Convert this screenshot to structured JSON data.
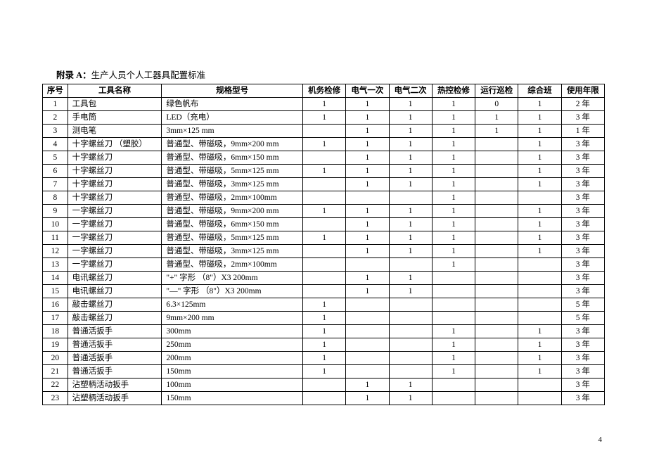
{
  "title_prefix": "附录 A：",
  "title_rest": "生产人员个人工器具配置标准",
  "page_number": "4",
  "headers": [
    "序号",
    "工具名称",
    "规格型号",
    "机务检修",
    "电气一次",
    "电气二次",
    "热控检修",
    "运行巡检",
    "综合班",
    "使用年限"
  ],
  "rows": [
    {
      "idx": "1",
      "name": "工具包",
      "spec": "绿色帆布",
      "v": [
        "1",
        "1",
        "1",
        "1",
        "0",
        "1"
      ],
      "life": "2 年"
    },
    {
      "idx": "2",
      "name": "手电筒",
      "spec": "LED（充电）",
      "v": [
        "1",
        "1",
        "1",
        "1",
        "1",
        "1"
      ],
      "life": "3 年"
    },
    {
      "idx": "3",
      "name": "测电笔",
      "spec": "3mm×125 mm",
      "v": [
        "",
        "1",
        "1",
        "1",
        "1",
        "1"
      ],
      "life": "1 年"
    },
    {
      "idx": "4",
      "name": "十字螺丝刀 （塑胶）",
      "spec": "普通型、带磁吸，9mm×200 mm",
      "v": [
        "1",
        "1",
        "1",
        "1",
        "",
        "1"
      ],
      "life": "3 年"
    },
    {
      "idx": "5",
      "name": "十字螺丝刀",
      "spec": "普通型、带磁吸，6mm×150 mm",
      "v": [
        "",
        "1",
        "1",
        "1",
        "",
        "1"
      ],
      "life": "3 年"
    },
    {
      "idx": "6",
      "name": "十字螺丝刀",
      "spec": "普通型、带磁吸，5mm×125 mm",
      "v": [
        "1",
        "1",
        "1",
        "1",
        "",
        "1"
      ],
      "life": "3 年"
    },
    {
      "idx": "7",
      "name": "十字螺丝刀",
      "spec": "普通型、带磁吸，3mm×125 mm",
      "v": [
        "",
        "1",
        "1",
        "1",
        "",
        "1"
      ],
      "life": "3 年"
    },
    {
      "idx": "8",
      "name": "十字螺丝刀",
      "spec": "普通型、带磁吸，2mm×100mm",
      "v": [
        "",
        "",
        "",
        "1",
        "",
        ""
      ],
      "life": "3 年"
    },
    {
      "idx": "9",
      "name": "一字螺丝刀",
      "spec": "普通型、带磁吸，9mm×200 mm",
      "v": [
        "1",
        "1",
        "1",
        "1",
        "",
        "1"
      ],
      "life": "3 年"
    },
    {
      "idx": "10",
      "name": "一字螺丝刀",
      "spec": "普通型、带磁吸，6mm×150 mm",
      "v": [
        "",
        "1",
        "1",
        "1",
        "",
        "1"
      ],
      "life": "3 年"
    },
    {
      "idx": "11",
      "name": "一字螺丝刀",
      "spec": "普通型、带磁吸，5mm×125 mm",
      "v": [
        "1",
        "1",
        "1",
        "1",
        "",
        "1"
      ],
      "life": "3 年"
    },
    {
      "idx": "12",
      "name": "一字螺丝刀",
      "spec": "普通型、带磁吸，3mm×125 mm",
      "v": [
        "",
        "1",
        "1",
        "1",
        "",
        "1"
      ],
      "life": "3 年"
    },
    {
      "idx": "13",
      "name": "一字螺丝刀",
      "spec": "普通型、带磁吸，2mm×100mm",
      "v": [
        "",
        "",
        "",
        "1",
        "",
        ""
      ],
      "life": "3 年"
    },
    {
      "idx": "14",
      "name": "电讯螺丝刀",
      "spec": "\"+\" 字形 （8\"）X3    200mm",
      "v": [
        "",
        "1",
        "1",
        "",
        "",
        ""
      ],
      "life": "3 年"
    },
    {
      "idx": "15",
      "name": "电讯螺丝刀",
      "spec": "\"—\" 字形 （8\"）X3   200mm",
      "v": [
        "",
        "1",
        "1",
        "",
        "",
        ""
      ],
      "life": "3 年"
    },
    {
      "idx": "16",
      "name": "敲击螺丝刀",
      "spec": "6.3×125mm",
      "v": [
        "1",
        "",
        "",
        "",
        "",
        ""
      ],
      "life": "5 年"
    },
    {
      "idx": "17",
      "name": "敲击螺丝刀",
      "spec": "9mm×200 mm",
      "v": [
        "1",
        "",
        "",
        "",
        "",
        ""
      ],
      "life": "5 年"
    },
    {
      "idx": "18",
      "name": "普通活扳手",
      "spec": "300mm",
      "v": [
        "1",
        "",
        "",
        "1",
        "",
        "1"
      ],
      "life": "3 年"
    },
    {
      "idx": "19",
      "name": "普通活扳手",
      "spec": "250mm",
      "v": [
        "1",
        "",
        "",
        "1",
        "",
        "1"
      ],
      "life": "3 年"
    },
    {
      "idx": "20",
      "name": "普通活扳手",
      "spec": "200mm",
      "v": [
        "1",
        "",
        "",
        "1",
        "",
        "1"
      ],
      "life": "3 年"
    },
    {
      "idx": "21",
      "name": "普通活扳手",
      "spec": "150mm",
      "v": [
        "1",
        "",
        "",
        "1",
        "",
        "1"
      ],
      "life": "3 年"
    },
    {
      "idx": "22",
      "name": "沾塑柄活动扳手",
      "spec": "100mm",
      "v": [
        "",
        "1",
        "1",
        "",
        "",
        ""
      ],
      "life": "3 年"
    },
    {
      "idx": "23",
      "name": "沾塑柄活动扳手",
      "spec": "150mm",
      "v": [
        "",
        "1",
        "1",
        "",
        "",
        ""
      ],
      "life": "3 年"
    }
  ]
}
